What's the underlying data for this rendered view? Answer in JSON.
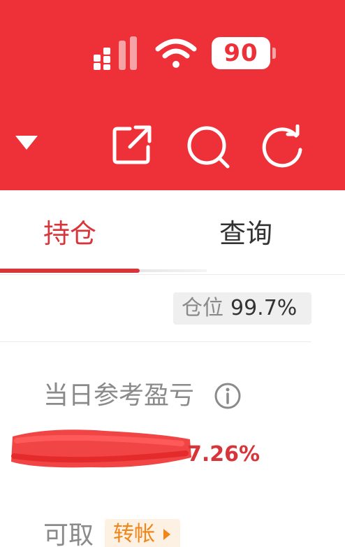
{
  "status_bar": {
    "battery_level": "90"
  },
  "toolbar": {
    "icons": [
      "dropdown-icon",
      "share-icon",
      "search-icon",
      "refresh-icon"
    ]
  },
  "tabs": [
    {
      "label": "持仓",
      "active": true
    },
    {
      "label": "查询",
      "active": false
    }
  ],
  "position": {
    "label": "仓位",
    "value": "99.7%"
  },
  "pnl": {
    "label": "当日参考盈亏",
    "value_visible": "7.26%"
  },
  "withdraw": {
    "label": "可取",
    "transfer_label": "转帐"
  },
  "colors": {
    "header": "#ee3139",
    "accent": "#d8353a",
    "transfer": "#f0861a"
  }
}
